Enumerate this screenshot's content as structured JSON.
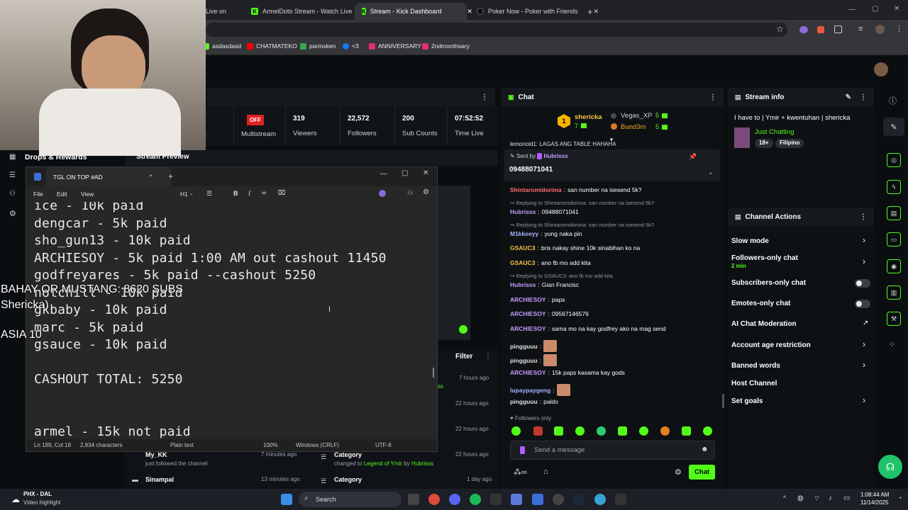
{
  "browser": {
    "tabs": [
      {
        "label": "Live on",
        "icon": "kick-icon"
      },
      {
        "label": "ArmelDoto Stream - Watch Live",
        "icon": "kick-icon"
      },
      {
        "label": "Stream - Kick Dashboard",
        "icon": "kick-icon",
        "active": true
      },
      {
        "label": "Poker Now - Poker with Friends",
        "icon": "poker-icon"
      }
    ],
    "bookmarks": [
      "asdasdasd",
      "CHATMATEKO",
      "parmsken",
      "<3",
      "ANNIVERSARY",
      "2ndmonthsary"
    ]
  },
  "dashboard": {
    "multistream_badge": "OFF",
    "stats": [
      {
        "value": "",
        "label": "Multistream"
      },
      {
        "value": "319",
        "label": "Viewers"
      },
      {
        "value": "22,572",
        "label": "Followers"
      },
      {
        "value": "200",
        "label": "Sub Counts"
      },
      {
        "value": "07:52:52",
        "label": "Time Live"
      }
    ],
    "stats_cut_label": "r",
    "drops_label": "Drops & Rewards",
    "stream_preview_label": "Stream Preview",
    "filter_label": "Filter",
    "activity": [
      {
        "time": "7 hours ago"
      },
      {
        "time": "22 hours ago"
      },
      {
        "time": "22 hours ago"
      },
      {
        "time": "22 hours ago"
      },
      {
        "time": "7 minutes ago"
      },
      {
        "time": "13 minutes ago"
      },
      {
        "time": "1 day ago"
      }
    ],
    "activity_items": [
      {
        "user": "My_KK",
        "text": "just followed the channel"
      },
      {
        "user": "Sinampal",
        "text": ""
      }
    ],
    "activity_right": [
      {
        "title": "Category",
        "prefix": "changed to",
        "link": "Legend of Ymir",
        "by_prefix": "by",
        "by": "Hubrisss"
      },
      {
        "title": "Category",
        "prefix": "",
        "link": "",
        "by_prefix": "",
        "by": ""
      }
    ],
    "ss_fragment": "ss"
  },
  "chat": {
    "title": "Chat",
    "leaders": [
      {
        "rank": "1",
        "name": "shericka",
        "count": "7"
      },
      {
        "name": "Vegas_XP",
        "count": "5"
      },
      {
        "name": "Bund3m",
        "count": "5"
      }
    ],
    "cut_message": "lemonold1: LAGAS ANG TABLE HAHAHA",
    "pinned": {
      "sent_by_label": "Sent by",
      "user": "Hubrisss",
      "text": "09488071041"
    },
    "messages": [
      {
        "type": "msg",
        "user": "Shintaromidorima",
        "color": "#ff6b6b",
        "text": "san number na isesend 5k?"
      },
      {
        "type": "reply",
        "text": "Replying to Shintaromidorima: san number na isesend 5k?"
      },
      {
        "type": "msg",
        "user": "Hubrisss",
        "color": "#c29bff",
        "text": "09488071041"
      },
      {
        "type": "reply",
        "text": "Replying to Shintaromidorima: san number na isesend 5k?"
      },
      {
        "type": "msg",
        "user": "M1kkeeyy",
        "color": "#a5b4ff",
        "text": "yung naka pin"
      },
      {
        "type": "msg",
        "user": "GSAUC3",
        "color": "#f5c542",
        "text": "bris nakay shine 10k sinabihan ko na"
      },
      {
        "type": "msg",
        "user": "GSAUC3",
        "color": "#f5c542",
        "text": "ano fb mo add kita"
      },
      {
        "type": "reply",
        "text": "Replying to GSAUC3: ano fb mo add kita"
      },
      {
        "type": "msg",
        "user": "Hubrisss",
        "color": "#c29bff",
        "text": "Gian Francisc"
      },
      {
        "type": "msg",
        "user": "ARCHIESOY",
        "color": "#c29bff",
        "text": "paps"
      },
      {
        "type": "msg",
        "user": "ARCHIESOY",
        "color": "#c29bff",
        "text": "09567146576"
      },
      {
        "type": "msg",
        "user": "ARCHIESOY",
        "color": "#c29bff",
        "text": "sama mo na kay godfrey ako na mag send"
      },
      {
        "type": "msg",
        "user": "pingguuu",
        "color": "#e0e0e0",
        "text": ""
      },
      {
        "type": "msg",
        "user": "pingguuu",
        "color": "#e0e0e0",
        "text": ""
      },
      {
        "type": "msg",
        "user": "ARCHIESOY",
        "color": "#c29bff",
        "text": "15k paps kasama kay gods"
      },
      {
        "type": "msg",
        "user": "lupaypaygeng",
        "color": "#a5b4ff",
        "text": ""
      },
      {
        "type": "msg",
        "user": "pingguuu",
        "color": "#e0e0e0",
        "text": "paldo"
      }
    ],
    "followers_only": "Followers only",
    "input_placeholder": "Send a message",
    "send_label": "Chat"
  },
  "stream_info": {
    "title": "Stream info",
    "stream_title": "I have to | Ymir + kwentuhan | shericka",
    "category": "Just Chatting",
    "tags": [
      "18+",
      "Filipino"
    ]
  },
  "channel_actions": {
    "title": "Channel Actions",
    "items": [
      {
        "label": "Slow mode",
        "kind": "chevron"
      },
      {
        "label": "Followers-only chat",
        "sub": "2 min",
        "kind": "chevron"
      },
      {
        "label": "Subscribers-only chat",
        "kind": "toggle"
      },
      {
        "label": "Emotes-only chat",
        "kind": "toggle"
      },
      {
        "label": "AI Chat Moderation",
        "kind": "external"
      },
      {
        "label": "Account age restriction",
        "kind": "chevron"
      },
      {
        "label": "Banned words",
        "kind": "chevron"
      },
      {
        "label": "Host Channel",
        "kind": "none"
      },
      {
        "label": "Set goals",
        "kind": "chevron"
      }
    ]
  },
  "notepad": {
    "title": "TGL ON TOP #AD",
    "menu": [
      "File",
      "Edit",
      "View"
    ],
    "heading_label": "H1",
    "lines": [
      "ice - 10k paid",
      "dengcar - 5k paid",
      "sho_gun13 - 10k paid",
      "ARCHIESOY - 5k paid 1:00 AM out cashout 11450",
      "godfreyares - 5k paid --cashout 5250",
      "notchill - 10k paid",
      "gkbaby - 10k paid",
      "marc - 5k paid",
      "gsauce - 10k paid",
      "",
      "CASHOUT TOTAL: 5250",
      "",
      "",
      "armel - 15k not paid"
    ],
    "status": {
      "position": "Ln 189, Col 18",
      "chars": "2,834 characters",
      "format": "Plain text",
      "zoom": "100%",
      "eol": "Windows (CRLF)",
      "encoding": "UTF-8"
    }
  },
  "overlay": {
    "line1": "BAHAY OR MUSTANG: 8620 SUBS",
    "line2": "Shericka)",
    "line3": "ASIA 10"
  },
  "taskbar": {
    "weather_location": "PHX - DAL",
    "weather_sub": "Video highlight",
    "search_label": "Search",
    "time": "1:08:44 AM",
    "date": "11/14/2025"
  }
}
